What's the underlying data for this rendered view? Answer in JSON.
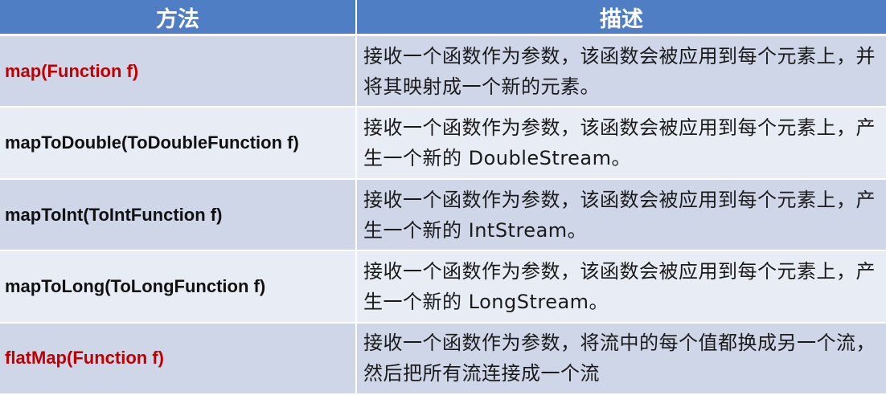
{
  "header": {
    "method_label": "方法",
    "description_label": "描述"
  },
  "rows": [
    {
      "method": "map(Function f)",
      "highlight": true,
      "description": "接收一个函数作为参数，该函数会被应用到每个元素上，并将其映射成一个新的元素。"
    },
    {
      "method": "mapToDouble(ToDoubleFunction f)",
      "highlight": false,
      "description": "接收一个函数作为参数，该函数会被应用到每个元素上，产生一个新的 DoubleStream。"
    },
    {
      "method": "mapToInt(ToIntFunction f)",
      "highlight": false,
      "description": "接收一个函数作为参数，该函数会被应用到每个元素上，产生一个新的 IntStream。"
    },
    {
      "method": "mapToLong(ToLongFunction f)",
      "highlight": false,
      "description": "接收一个函数作为参数，该函数会被应用到每个元素上，产生一个新的 LongStream。"
    },
    {
      "method": "flatMap(Function f)",
      "highlight": true,
      "description": "接收一个函数作为参数，将流中的每个值都换成另一个流，然后把所有流连接成一个流"
    }
  ],
  "colors": {
    "header_bg": "#4f7ec4",
    "row_dark": "#cfd6e8",
    "row_light": "#e8ecf4",
    "highlight_text": "#c00000"
  }
}
